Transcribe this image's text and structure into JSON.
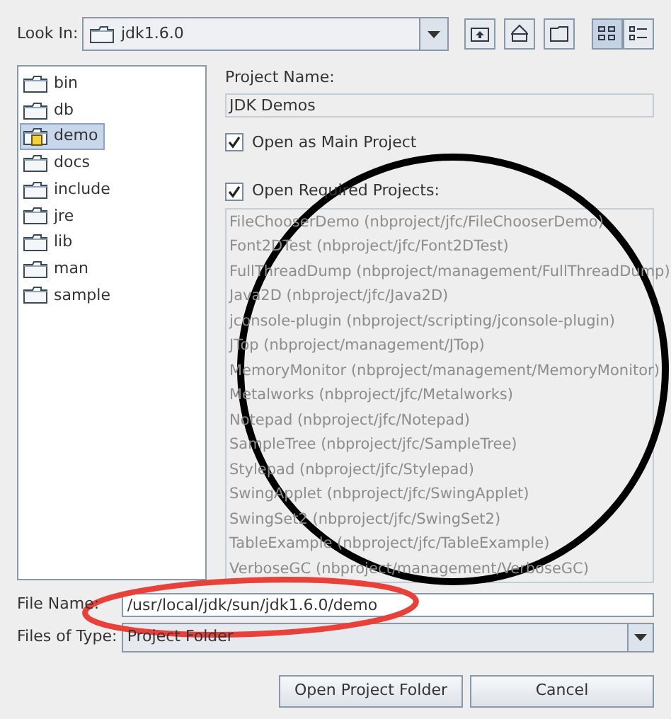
{
  "look_in": {
    "label": "Look In:",
    "value": "jdk1.6.0"
  },
  "toolbar": [
    {
      "kind": "up",
      "selected": false
    },
    {
      "kind": "home",
      "selected": false
    },
    {
      "kind": "new-folder",
      "selected": false
    },
    {
      "kind": "list-view",
      "selected": true
    },
    {
      "kind": "details-view",
      "selected": false
    }
  ],
  "folders": [
    {
      "name": "bin",
      "selected": false,
      "project": false
    },
    {
      "name": "db",
      "selected": false,
      "project": false
    },
    {
      "name": "demo",
      "selected": true,
      "project": true
    },
    {
      "name": "docs",
      "selected": false,
      "project": false
    },
    {
      "name": "include",
      "selected": false,
      "project": false
    },
    {
      "name": "jre",
      "selected": false,
      "project": false
    },
    {
      "name": "lib",
      "selected": false,
      "project": false
    },
    {
      "name": "man",
      "selected": false,
      "project": false
    },
    {
      "name": "sample",
      "selected": false,
      "project": false
    }
  ],
  "project_name": {
    "label": "Project Name:",
    "value": "JDK Demos"
  },
  "open_as_main": {
    "label": "Open as Main Project",
    "checked": true
  },
  "open_required": {
    "label": "Open Required Projects:",
    "checked": true
  },
  "required_projects": [
    "FileChooserDemo (nbproject/jfc/FileChooserDemo)",
    "Font2DTest (nbproject/jfc/Font2DTest)",
    "FullThreadDump (nbproject/management/FullThreadDump)",
    "Java2D (nbproject/jfc/Java2D)",
    "jconsole-plugin (nbproject/scripting/jconsole-plugin)",
    "JTop (nbproject/management/JTop)",
    "MemoryMonitor (nbproject/management/MemoryMonitor)",
    "Metalworks (nbproject/jfc/Metalworks)",
    "Notepad (nbproject/jfc/Notepad)",
    "SampleTree (nbproject/jfc/SampleTree)",
    "Stylepad (nbproject/jfc/Stylepad)",
    "SwingApplet (nbproject/jfc/SwingApplet)",
    "SwingSet2 (nbproject/jfc/SwingSet2)",
    "TableExample (nbproject/jfc/TableExample)",
    "VerboseGC (nbproject/management/VerboseGC)"
  ],
  "file_name": {
    "label": "File Name:",
    "value": "/usr/local/jdk/sun/jdk1.6.0/demo"
  },
  "files_of_type": {
    "label": "Files of Type:",
    "value": "Project Folder"
  },
  "buttons": [
    "Open Project Folder",
    "Cancel"
  ]
}
